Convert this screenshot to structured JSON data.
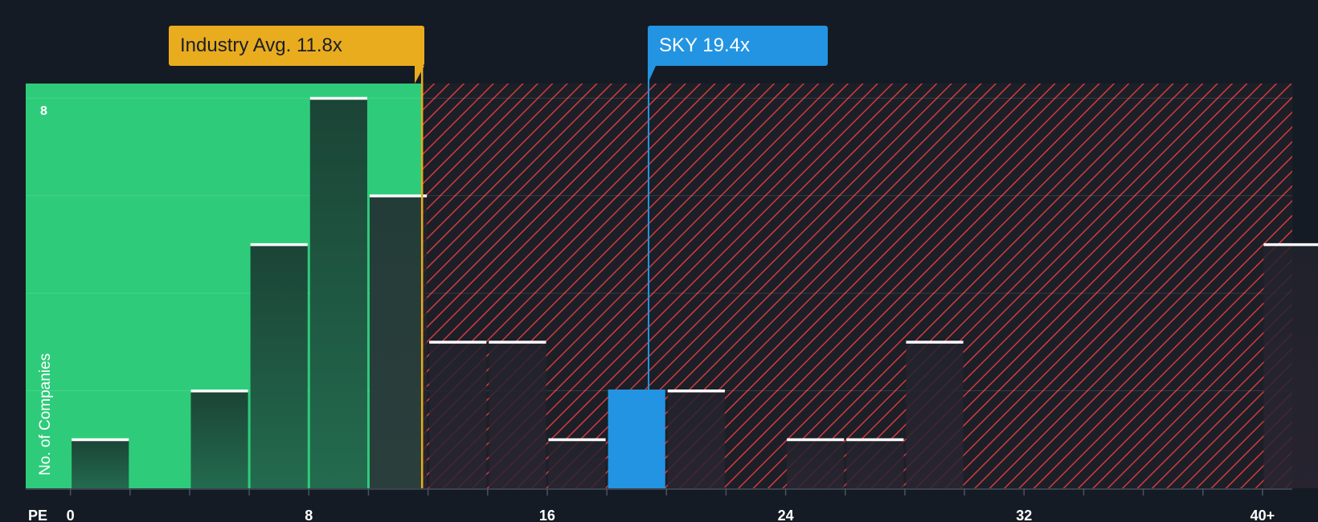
{
  "chart_data": {
    "type": "bar",
    "xlabel": "PE",
    "ylabel": "No. of Companies",
    "x_ticks": [
      "0",
      "8",
      "16",
      "24",
      "32",
      "40+"
    ],
    "x_tick_values": [
      0,
      8,
      16,
      24,
      32,
      40
    ],
    "y_tick_label": "8",
    "xlim": [
      -1.5,
      41
    ],
    "ylim": [
      0,
      8.3
    ],
    "bin_width": 2,
    "bins": [
      {
        "start": 0,
        "count": 1
      },
      {
        "start": 2,
        "count": 0
      },
      {
        "start": 4,
        "count": 2
      },
      {
        "start": 6,
        "count": 5
      },
      {
        "start": 8,
        "count": 8
      },
      {
        "start": 10,
        "count": 6
      },
      {
        "start": 12,
        "count": 3
      },
      {
        "start": 14,
        "count": 3
      },
      {
        "start": 16,
        "count": 1
      },
      {
        "start": 18,
        "count": 2,
        "highlight": true
      },
      {
        "start": 20,
        "count": 2
      },
      {
        "start": 22,
        "count": 0
      },
      {
        "start": 24,
        "count": 1
      },
      {
        "start": 26,
        "count": 1
      },
      {
        "start": 28,
        "count": 3
      },
      {
        "start": 30,
        "count": 0
      },
      {
        "start": 32,
        "count": 0
      },
      {
        "start": 34,
        "count": 0
      },
      {
        "start": 36,
        "count": 0
      },
      {
        "start": 38,
        "count": 0
      },
      {
        "start": 40,
        "count": 5
      }
    ],
    "industry_avg": {
      "label": "Industry Avg. 11.8x",
      "value": 11.8
    },
    "subject": {
      "label": "SKY 19.4x",
      "value": 19.4
    },
    "colors": {
      "background": "#151b24",
      "undervalued_zone": "#2ecc7a",
      "overvalued_hatch": "#d43a3a",
      "bar_in_green": "#1e4a3c",
      "bar_in_red": "#262530",
      "highlight_bar": "#2394e2",
      "industry_marker": "#e9ac1e",
      "bar_cap": "#ffffff"
    }
  }
}
